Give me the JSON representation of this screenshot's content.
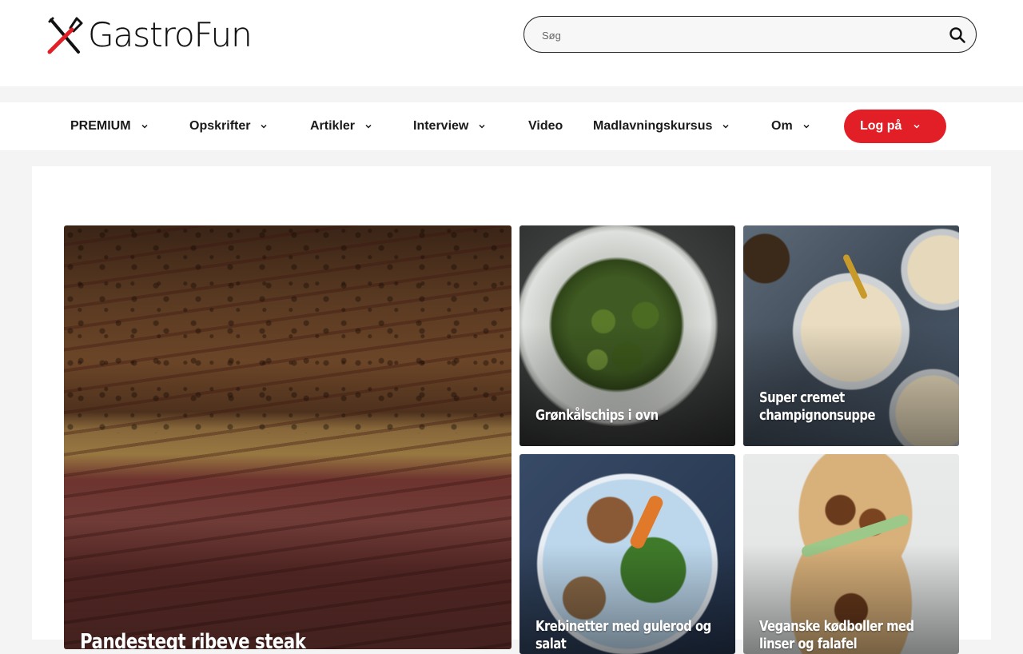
{
  "header": {
    "logo_text": "GastroFun",
    "search": {
      "placeholder": "Søg",
      "value": ""
    }
  },
  "nav": {
    "items": [
      {
        "label": "PREMIUM",
        "dropdown": true
      },
      {
        "label": "Opskrifter",
        "dropdown": true
      },
      {
        "label": "Artikler",
        "dropdown": true
      },
      {
        "label": "Interview",
        "dropdown": true
      },
      {
        "label": "Video",
        "dropdown": false
      },
      {
        "label": "Madlavningskursus",
        "dropdown": true
      },
      {
        "label": "Om",
        "dropdown": true
      }
    ],
    "login_label": "Log på"
  },
  "cards": [
    {
      "title": "Pandestegt ribeye steak",
      "image": "steak-photo"
    },
    {
      "title": "Grønkålschips i ovn",
      "image": "kale-chips-photo"
    },
    {
      "title": "Super cremet champignonsuppe",
      "image": "mushroom-soup-photo"
    },
    {
      "title": "Krebinetter med gulerod og salat",
      "image": "meatballs-salad-photo"
    },
    {
      "title": "Veganske kødboller med linser og falafel",
      "image": "vegan-pita-photo"
    }
  ],
  "colors": {
    "accent": "#e21f26",
    "text": "#1a1a1a",
    "background": "#f4f4f4"
  }
}
